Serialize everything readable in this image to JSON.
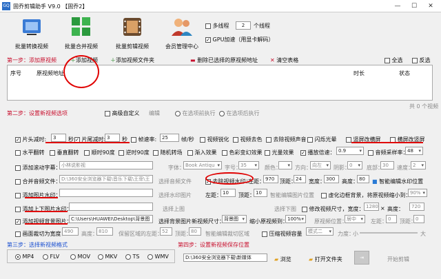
{
  "title": "固乔剪辑助手 V9.0 【固乔2】",
  "window_controls": {
    "min": "—",
    "max": "☐",
    "close": "✕"
  },
  "toolbar": {
    "buttons": [
      "批量转换视频",
      "批量合并视频",
      "批量剪辑视频",
      "会员管理中心"
    ],
    "multithread_label": "多线程",
    "thread_count": "2",
    "thread_unit": "个线程",
    "gpu_label": "GPU加速（用显卡解码）"
  },
  "step1": {
    "title": "第一步：添加原视频",
    "add_video": "添加视频",
    "add_folder": "添加视频文件夹",
    "delete_selected": "删除已选择的原视频地址",
    "clear_table": "清空表格",
    "select_all": "全选",
    "invert": "反选",
    "columns": [
      "序号",
      "原视频地址",
      "时长",
      "状态"
    ],
    "count": "共 0 个视频"
  },
  "step2": {
    "title": "第二步：设置新视频选项",
    "advanced": "高级自定义",
    "edit": "编辑",
    "before_exec": "在选项前执行",
    "after_exec": "在选项后执行",
    "row1": {
      "head_cut": "片头减时:",
      "head_val": "3",
      "sec1": "秒",
      "tail_cut": "片尾减时:",
      "tail_val": "3",
      "sec2": "秒",
      "fps_label": "帧速率:",
      "fps_val": "25",
      "fps_unit": "帧/秒",
      "sharpen": "视频锐化",
      "decolor": "视频去色",
      "remove_audio": "去除视频声音",
      "flash": "闪烁光晕",
      "vblur": "竖屏改横屏",
      "hblur": "横屏改竖屏"
    },
    "row2": {
      "hflip": "水平翻转",
      "vflip": "垂直翻转",
      "cw90": "顺时90度",
      "ccw90": "逆时90度",
      "mosaic": "随机转场",
      "fade": "渐入效果",
      "color_fx": "色彩变幻效果",
      "light_fx": "光量效果",
      "speed_label": "播放倍速：",
      "speed_val": "0.9",
      "audio_rate": "音频采样率：",
      "audio_val": "48"
    },
    "row3": {
      "scroll_sub": "添加滚动字幕：",
      "scroll_placeholder": "小林说影视",
      "font_label": "字体：",
      "font_val": "Book Antiqu",
      "size_label": "字号：",
      "size_val": "35",
      "color_label": "颜色：",
      "dir_label": "方向：",
      "dir_val": "向左",
      "shadow_label": "阴影：",
      "shadow_val": "0",
      "bottom_label": "底部：",
      "bottom_val": "30",
      "speed_label": "速度：",
      "speed_val": "2"
    },
    "row4": {
      "merge_audio": "合并音频文件：",
      "merge_path": "D:\\360安全浏览器下载\\音乐下载\\王菲\\王",
      "choose_audio": "选择音频文件",
      "remove_wm": "去除视频水印：",
      "left_label": "左距：",
      "left_val": "970",
      "top_label": "顶距：",
      "top_val": "24",
      "w_label": "宽度：",
      "w_val": "300",
      "h_label": "高度：",
      "h_val": "80",
      "smart_pos": "智能编辑水印位置"
    },
    "row5": {
      "pic_wm": "添加图片水印：",
      "choose_wm": "选择水印图片",
      "left_label": "左距：",
      "left_val": "10",
      "top_label": "顶距：",
      "top_val": "10",
      "smart_pic": "智能编辑图片位置",
      "blur_bg": "虚化边框背景，将原视频缩小到：",
      "blur_val": "90%"
    },
    "row6": {
      "topbottom": "添加上下图片水印：",
      "choose_top": "选择上图",
      "choose_bottom": "选择下图",
      "change_size": "修改视频尺寸，宽度：",
      "w_val": "1280",
      "x": "×",
      "h_label": "高度：",
      "h_val": "720"
    },
    "row7": {
      "bg_pic": "添加视频背景图片：",
      "bg_path": "C:\\Users\\HUAWEI\\Desktop\\背景图片",
      "choose_bg": "选择背景图片",
      "new_size": "新视频尺寸：",
      "new_size_val": "背景图",
      "shrink": "缩小原视频到：",
      "shrink_val": "100%",
      "pos_label": "原视频位置：",
      "pos_val": "居中",
      "left_label": "左距：",
      "left_val": "0",
      "top_label": "顶距：",
      "top_val": "0"
    },
    "row8": {
      "crop": "画面裁切为宽度：",
      "crop_w": "490",
      "h_label": "高度：",
      "crop_h": "810",
      "keep_label": "保留区域的左距：",
      "keep_left": "52",
      "top_label": "顶距：",
      "keep_top": "80",
      "smart_crop": "智能编辑裁切区域",
      "compress": "压缩视频容量",
      "mode_val": "模式二",
      "power_label": "力度：",
      "small": "小",
      "big": "大"
    }
  },
  "step3": {
    "title": "第三步：选择新视频格式",
    "formats": [
      "MP4",
      "FLV",
      "MOV",
      "MKV",
      "TS",
      "WMV"
    ]
  },
  "step4": {
    "title": "第四步：设置新视频保存位置",
    "path": "D:\\360安全浏览器下载\\新媒体",
    "browse": "浏览",
    "open_folder": "打开文件夹",
    "start": "开始剪辑"
  }
}
